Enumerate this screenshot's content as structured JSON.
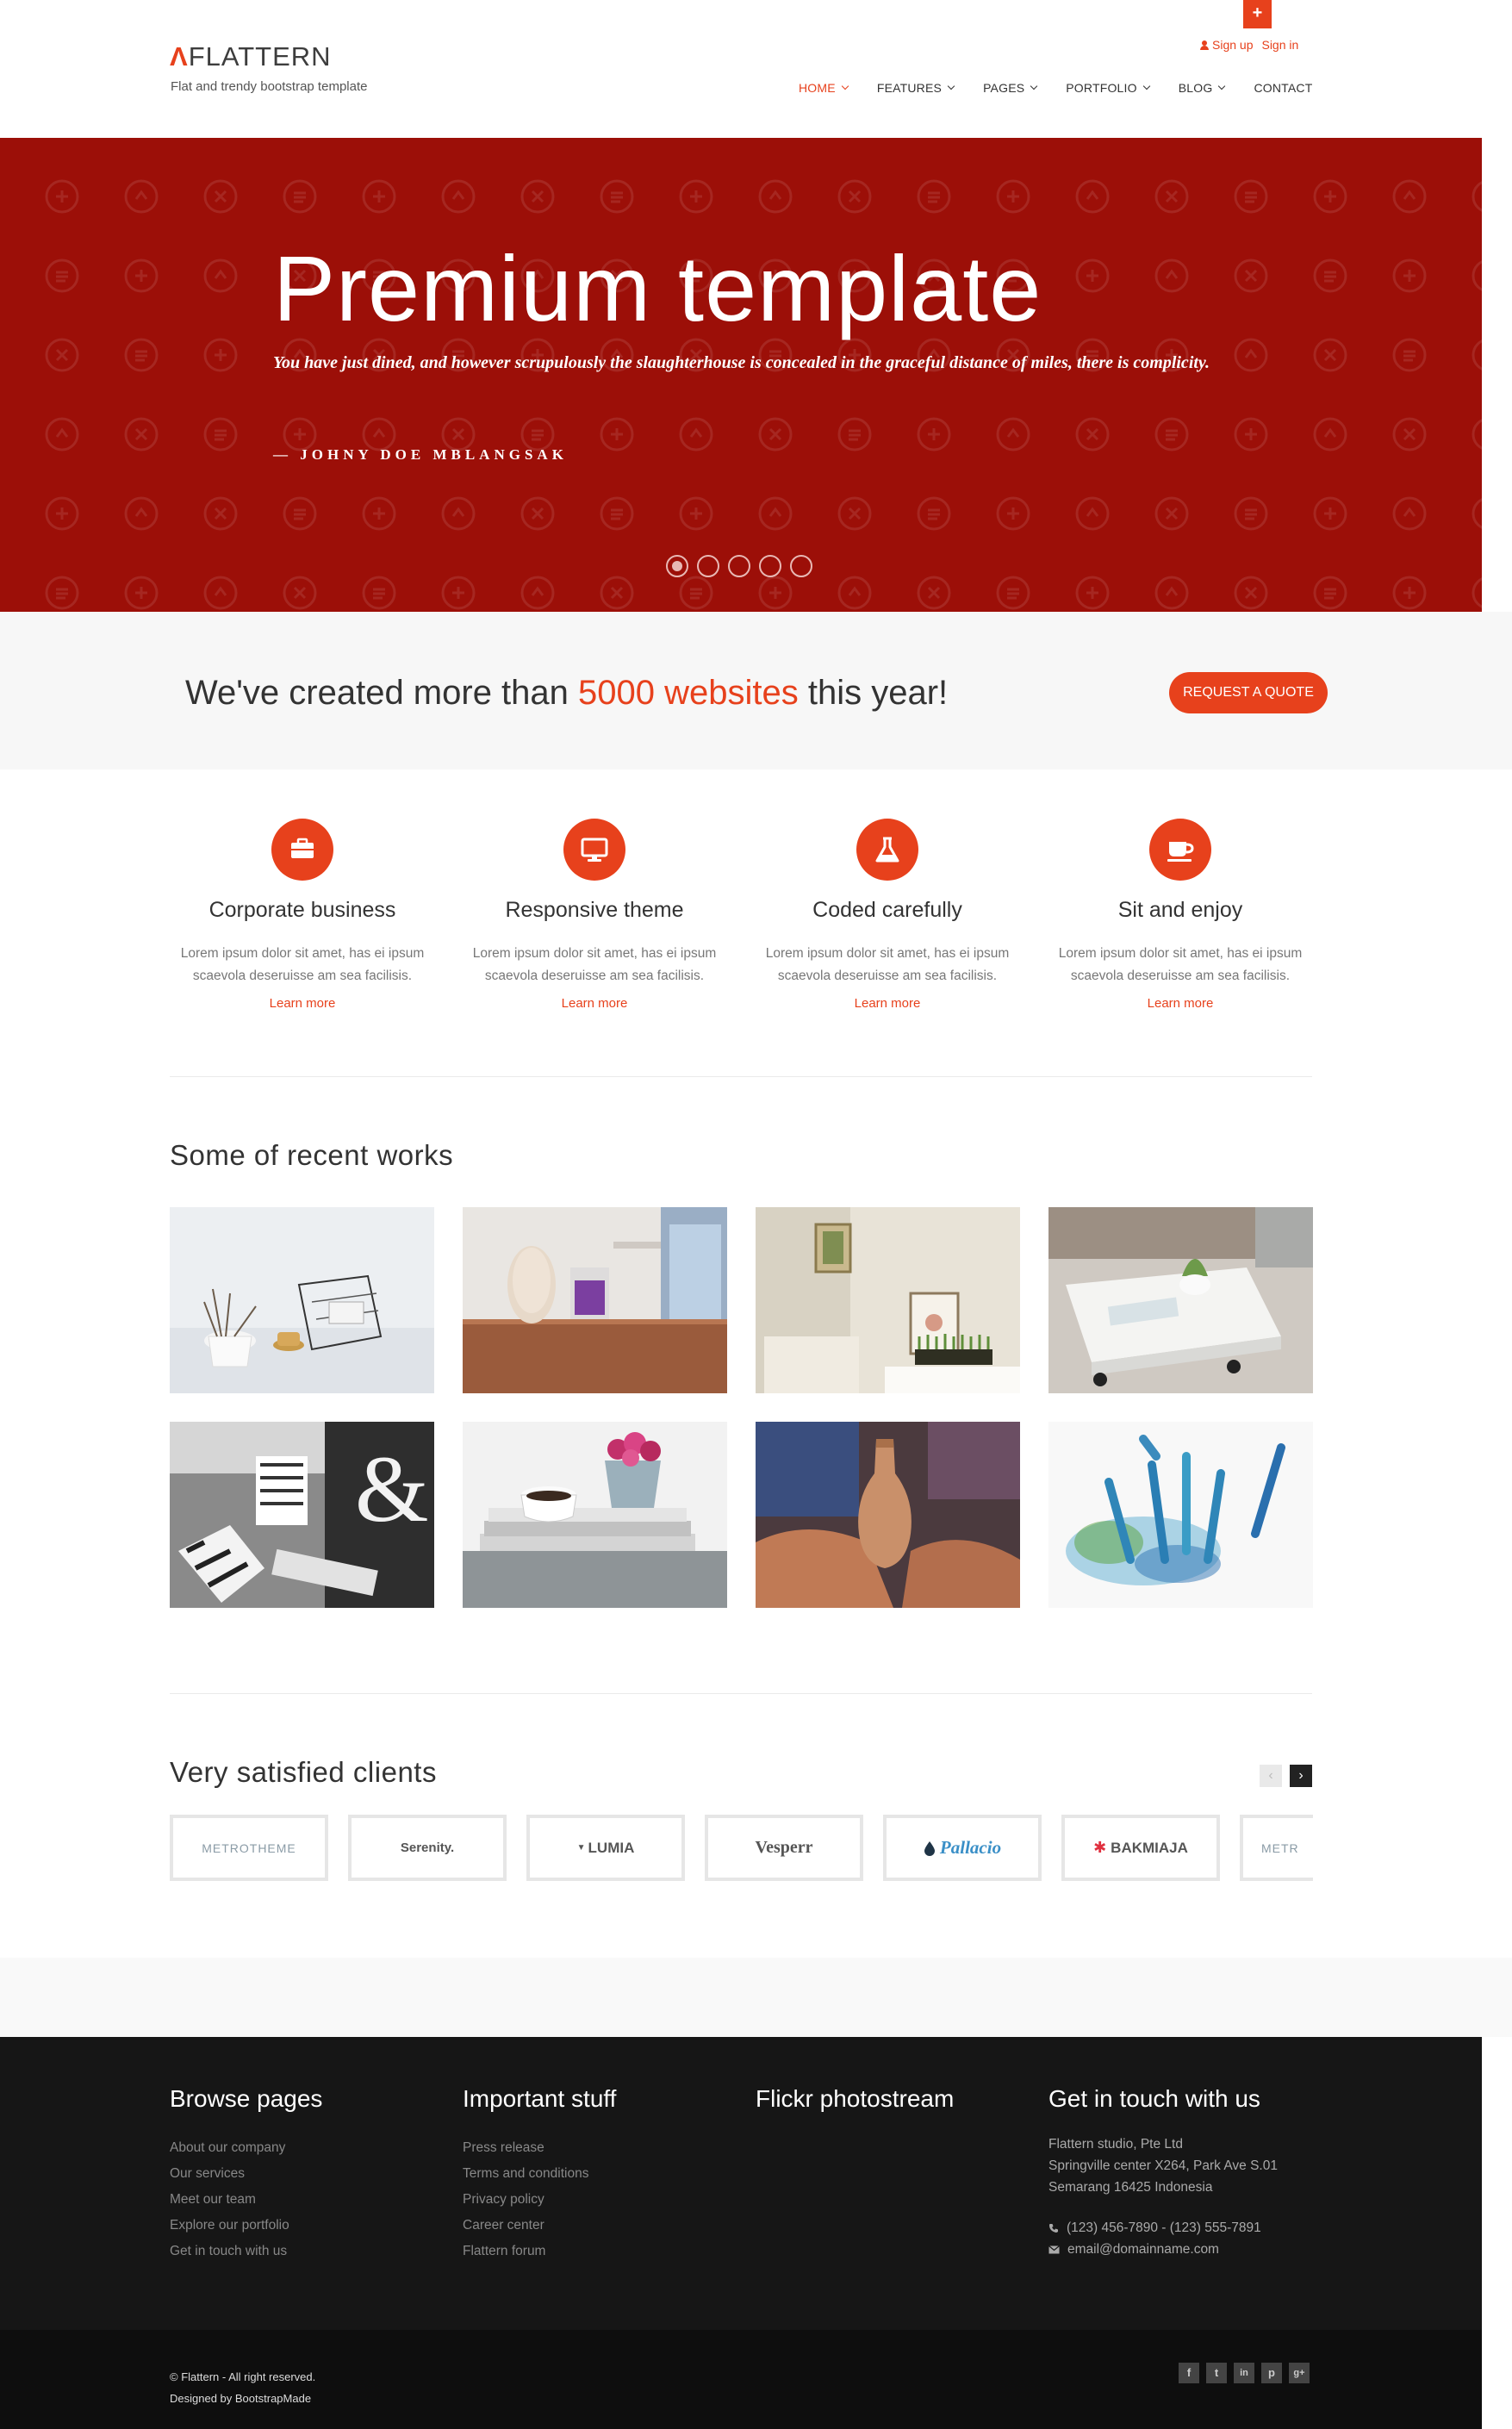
{
  "header": {
    "logo_mark": "Λ",
    "logo_text": "FLATTERN",
    "tagline": "Flat and trendy bootstrap template",
    "plus_tab": "+",
    "sign_up": "Sign up",
    "sign_in": "Sign in",
    "nav": [
      {
        "label": "HOME",
        "active": true,
        "dropdown": true
      },
      {
        "label": "FEATURES",
        "active": false,
        "dropdown": true
      },
      {
        "label": "PAGES",
        "active": false,
        "dropdown": true
      },
      {
        "label": "PORTFOLIO",
        "active": false,
        "dropdown": true
      },
      {
        "label": "BLOG",
        "active": false,
        "dropdown": true
      },
      {
        "label": "CONTACT",
        "active": false,
        "dropdown": false
      }
    ]
  },
  "hero": {
    "title": "Premium template",
    "quote": "You have just dined, and however scrupulously the slaughterhouse is concealed in the graceful distance of miles, there is complicity.",
    "author": "— JOHNY DOE MBLANGSAK",
    "slides": 5,
    "active_slide": 1,
    "background_color": "#9c0f08"
  },
  "callout": {
    "text_before": "We've created more than ",
    "highlight": "5000 websites",
    "text_after": " this year!",
    "button": "REQUEST A QUOTE"
  },
  "features": [
    {
      "icon": "briefcase-icon",
      "title": "Corporate business",
      "desc": "Lorem ipsum dolor sit amet, has ei ipsum scaevola deseruisse am sea facilisis.",
      "link": "Learn more"
    },
    {
      "icon": "monitor-icon",
      "title": "Responsive theme",
      "desc": "Lorem ipsum dolor sit amet, has ei ipsum scaevola deseruisse am sea facilisis.",
      "link": "Learn more"
    },
    {
      "icon": "flask-icon",
      "title": "Coded carefully",
      "desc": "Lorem ipsum dolor sit amet, has ei ipsum scaevola deseruisse am sea facilisis.",
      "link": "Learn more"
    },
    {
      "icon": "coffee-icon",
      "title": "Sit and enjoy",
      "desc": "Lorem ipsum dolor sit amet, has ei ipsum scaevola deseruisse am sea facilisis.",
      "link": "Learn more"
    }
  ],
  "works": {
    "title": "Some of recent works"
  },
  "clients": {
    "title": "Very satisfied clients",
    "prev": "‹",
    "next": "›",
    "logos": [
      "METROTHEME",
      "Serenity.",
      "LUMIA",
      "Vesperr",
      "Pallacio",
      "BAKMIAJA",
      "METR"
    ]
  },
  "footer": {
    "col1": {
      "title": "Browse pages",
      "links": [
        "About our company",
        "Our services",
        "Meet our team",
        "Explore our portfolio",
        "Get in touch with us"
      ]
    },
    "col2": {
      "title": "Important stuff",
      "links": [
        "Press release",
        "Terms and conditions",
        "Privacy policy",
        "Career center",
        "Flattern forum"
      ]
    },
    "col3": {
      "title": "Flickr photostream"
    },
    "col4": {
      "title": "Get in touch with us",
      "address": [
        "Flattern studio, Pte Ltd",
        "Springville center X264, Park Ave S.01",
        "Semarang 16425 Indonesia"
      ],
      "phone": "(123) 456-7890 - (123) 555-7891",
      "email": "email@domainname.com"
    },
    "copyright": "© Flattern - All right reserved.",
    "designed_by": "Designed by BootstrapMade",
    "social": [
      "f",
      "t",
      "in",
      "p",
      "g+"
    ]
  },
  "colors": {
    "accent": "#e7411c",
    "hero_bg": "#9c0f08",
    "footer_bg": "#161616"
  }
}
